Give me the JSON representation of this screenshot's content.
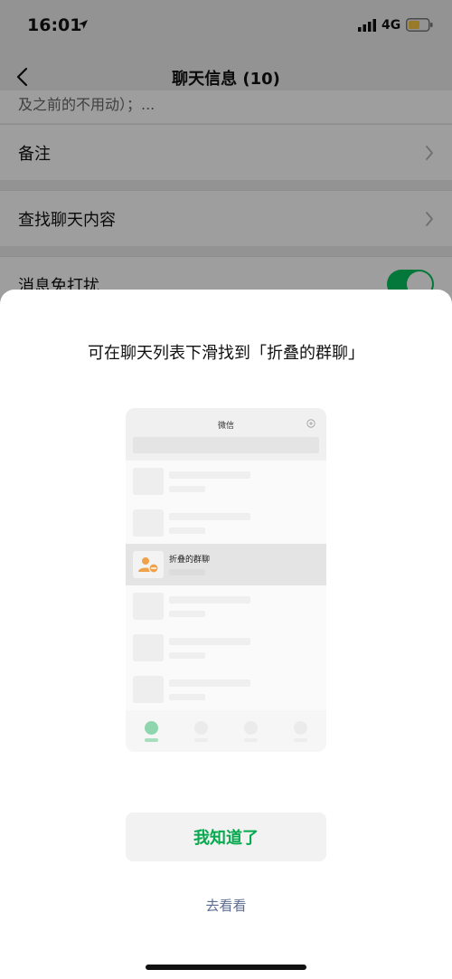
{
  "status_bar": {
    "time": "16:01",
    "network": "4G",
    "battery_color": "#f5c542"
  },
  "nav": {
    "title": "聊天信息 (10)"
  },
  "settings": {
    "cut_text": "及之前的不用动）；...",
    "rows": [
      {
        "label": "备注"
      },
      {
        "label": "查找聊天内容"
      },
      {
        "label": "消息免打扰",
        "toggle_on": true
      }
    ]
  },
  "sheet": {
    "title": "可在聊天列表下滑找到「折叠的群聊」",
    "preview": {
      "header_title": "微信",
      "highlight_label": "折叠的群聊"
    },
    "primary_button": "我知道了",
    "secondary_link": "去看看"
  },
  "colors": {
    "accent_green": "#07c160",
    "button_text_green": "#07a94f",
    "link_blue": "#5b6b92",
    "group_icon_orange": "#f0a24a"
  }
}
